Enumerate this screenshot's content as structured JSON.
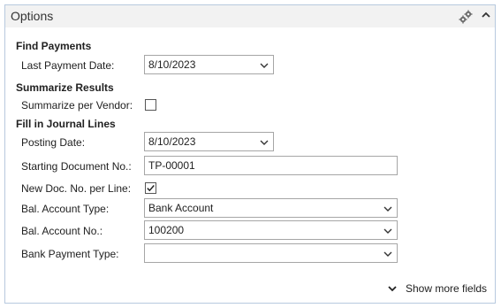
{
  "panel": {
    "title": "Options",
    "icons": {
      "settings": "gear-cluster-icon",
      "collapse": "chevron-up-icon"
    }
  },
  "sections": {
    "find_payments": {
      "title": "Find Payments",
      "last_payment_date": {
        "label": "Last Payment Date:",
        "value": "8/10/2023"
      }
    },
    "summarize_results": {
      "title": "Summarize Results",
      "summarize_per_vendor": {
        "label": "Summarize per Vendor:",
        "checked": false
      }
    },
    "fill_journal_lines": {
      "title": "Fill in Journal Lines",
      "posting_date": {
        "label": "Posting Date:",
        "value": "8/10/2023"
      },
      "starting_document_no": {
        "label": "Starting Document No.:",
        "value": "TP-00001"
      },
      "new_doc_no_per_line": {
        "label": "New Doc. No. per Line:",
        "checked": true
      },
      "bal_account_type": {
        "label": "Bal. Account Type:",
        "value": "Bank Account"
      },
      "bal_account_no": {
        "label": "Bal. Account No.:",
        "value": "100200"
      },
      "bank_payment_type": {
        "label": "Bank Payment Type:",
        "value": ""
      }
    }
  },
  "footer": {
    "show_more_label": "Show more fields"
  },
  "colors": {
    "border": "#b7c9de",
    "header_bg": "#f2f2f2",
    "field_border": "#a6a6a6"
  }
}
